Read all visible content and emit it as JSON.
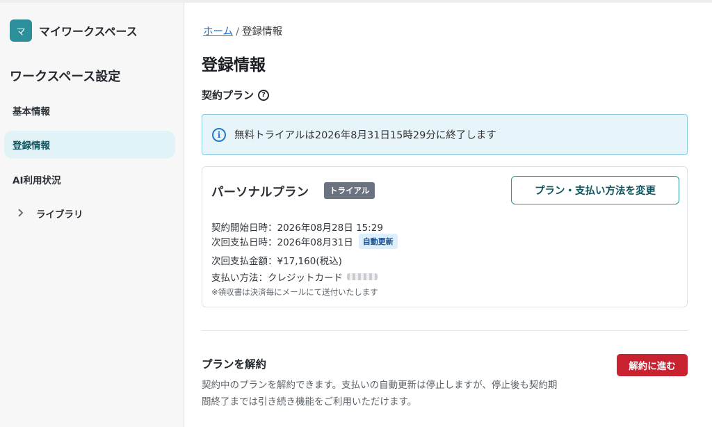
{
  "workspace": {
    "avatar_initial": "マ",
    "name": "マイワークスペース",
    "accent_color": "#2d8f99"
  },
  "sidebar": {
    "title": "ワークスペース設定",
    "items": [
      {
        "label": "基本情報",
        "active": false
      },
      {
        "label": "登録情報",
        "active": true
      },
      {
        "label": "AI利用状況",
        "active": false
      },
      {
        "label": "ライブラリ",
        "active": false,
        "expandable": true,
        "icon": "chevron-right-icon"
      }
    ]
  },
  "breadcrumb": {
    "home": "ホーム",
    "separator": "/",
    "current": "登録情報"
  },
  "page": {
    "title": "登録情報",
    "section_label": "契約プラン",
    "section_icon": "help-icon"
  },
  "notice": {
    "icon": "info-icon",
    "text": "無料トライアルは2026年8月31日15時29分に終了します"
  },
  "plan": {
    "name": "パーソナルプラン",
    "badge": "トライアル",
    "change_button": "プラン・支払い方法を変更",
    "start_label": "契約開始日時：",
    "start_value": "2026年08月28日 15:29",
    "next_payment_label": "次回支払日時：",
    "next_payment_value": "2026年08月31日",
    "auto_renew_badge": "自動更新",
    "amount_label": "次回支払金額：",
    "amount_value": "¥17,160(税込)",
    "method_label": "支払い方法：",
    "method_value": "クレジットカード",
    "receipt_note": "※領収書は決済毎にメールにて送付いたします"
  },
  "cancel": {
    "title": "プランを解約",
    "description": "契約中のプランを解約できます。支払いの自動更新は停止しますが、停止後も契約期間終了までは引き続き機能をご利用いただけます。",
    "button": "解約に進む",
    "button_color": "#c8212f"
  }
}
